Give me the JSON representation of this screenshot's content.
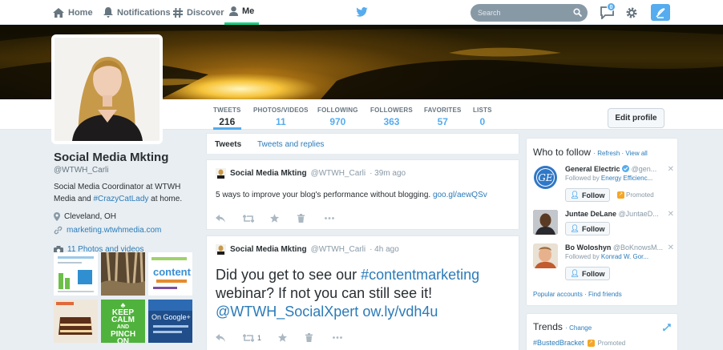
{
  "nav": {
    "home": "Home",
    "notifications": "Notifications",
    "discover": "Discover",
    "me": "Me",
    "search_placeholder": "Search",
    "messages_badge": "0"
  },
  "profile_nav": {
    "stats": [
      {
        "label": "TWEETS",
        "value": "216"
      },
      {
        "label": "PHOTOS/VIDEOS",
        "value": "11"
      },
      {
        "label": "FOLLOWING",
        "value": "970"
      },
      {
        "label": "FOLLOWERS",
        "value": "363"
      },
      {
        "label": "FAVORITES",
        "value": "57"
      },
      {
        "label": "LISTS",
        "value": "0"
      }
    ],
    "edit_profile": "Edit profile"
  },
  "profile": {
    "name": "Social Media Mkting",
    "handle": "@WTWH_Carli",
    "bio_prefix": "Social Media Coordinator at WTWH Media and ",
    "bio_hashtag": "#CrazyCatLady",
    "bio_suffix": " at home.",
    "location": "Cleveland, OH",
    "website": "marketing.wtwhmedia.com",
    "photos_link": "11 Photos and videos",
    "thumb_texts": {
      "keep_calm_1": "KEEP",
      "keep_calm_2": "CALM",
      "keep_calm_3": "AND",
      "keep_calm_4": "PINCH",
      "keep_calm_5": "ON",
      "on_google": "On Google+",
      "word_cloud": "content"
    }
  },
  "timeline": {
    "tabs": {
      "tweets": "Tweets",
      "replies": "Tweets and replies"
    },
    "tweets": [
      {
        "name": "Social Media Mkting",
        "handle": "@WTWH_Carli",
        "time": "· 39m ago",
        "text": "5 ways to improve your blog's performance without blogging. ",
        "link": "goo.gl/aewQSv"
      },
      {
        "name": "Social Media Mkting",
        "handle": "@WTWH_Carli",
        "time": "· 4h ago",
        "line1_prefix": "Did you get to see our ",
        "line1_hashtag": "#contentmarketing",
        "line2": "webinar? If not you can still see it!",
        "line3_mention": "@WTWH_SocialXpert",
        "line3_link": " ow.ly/vdh4u",
        "retweets": "1"
      }
    ]
  },
  "who_to_follow": {
    "title": "Who to follow",
    "refresh": "· Refresh",
    "view_all": "· View all",
    "suggestions": [
      {
        "name": "General Electric",
        "handle": "@gen...",
        "sub_prefix": "Followed by ",
        "sub_link": "Energy Efficienc...",
        "follow": "Follow",
        "promoted": "Promoted",
        "avatar_text": "GE"
      },
      {
        "name": "Juntae DeLane",
        "handle": "@JuntaeD...",
        "follow": "Follow"
      },
      {
        "name": "Bo Woloshyn",
        "handle": "@BoKnowsM...",
        "sub_prefix": "Followed by ",
        "sub_link": "Konrad W. Gor...",
        "follow": "Follow"
      }
    ],
    "popular_accounts": "Popular accounts",
    "find_friends": "· Find friends"
  },
  "trends": {
    "title": "Trends",
    "change": "· Change",
    "items": [
      {
        "tag": "#BustedBracket",
        "promoted": "Promoted"
      }
    ]
  },
  "colors": {
    "accent": "#55acee",
    "link": "#2b7bb9",
    "active_tab": "#19cf86"
  }
}
